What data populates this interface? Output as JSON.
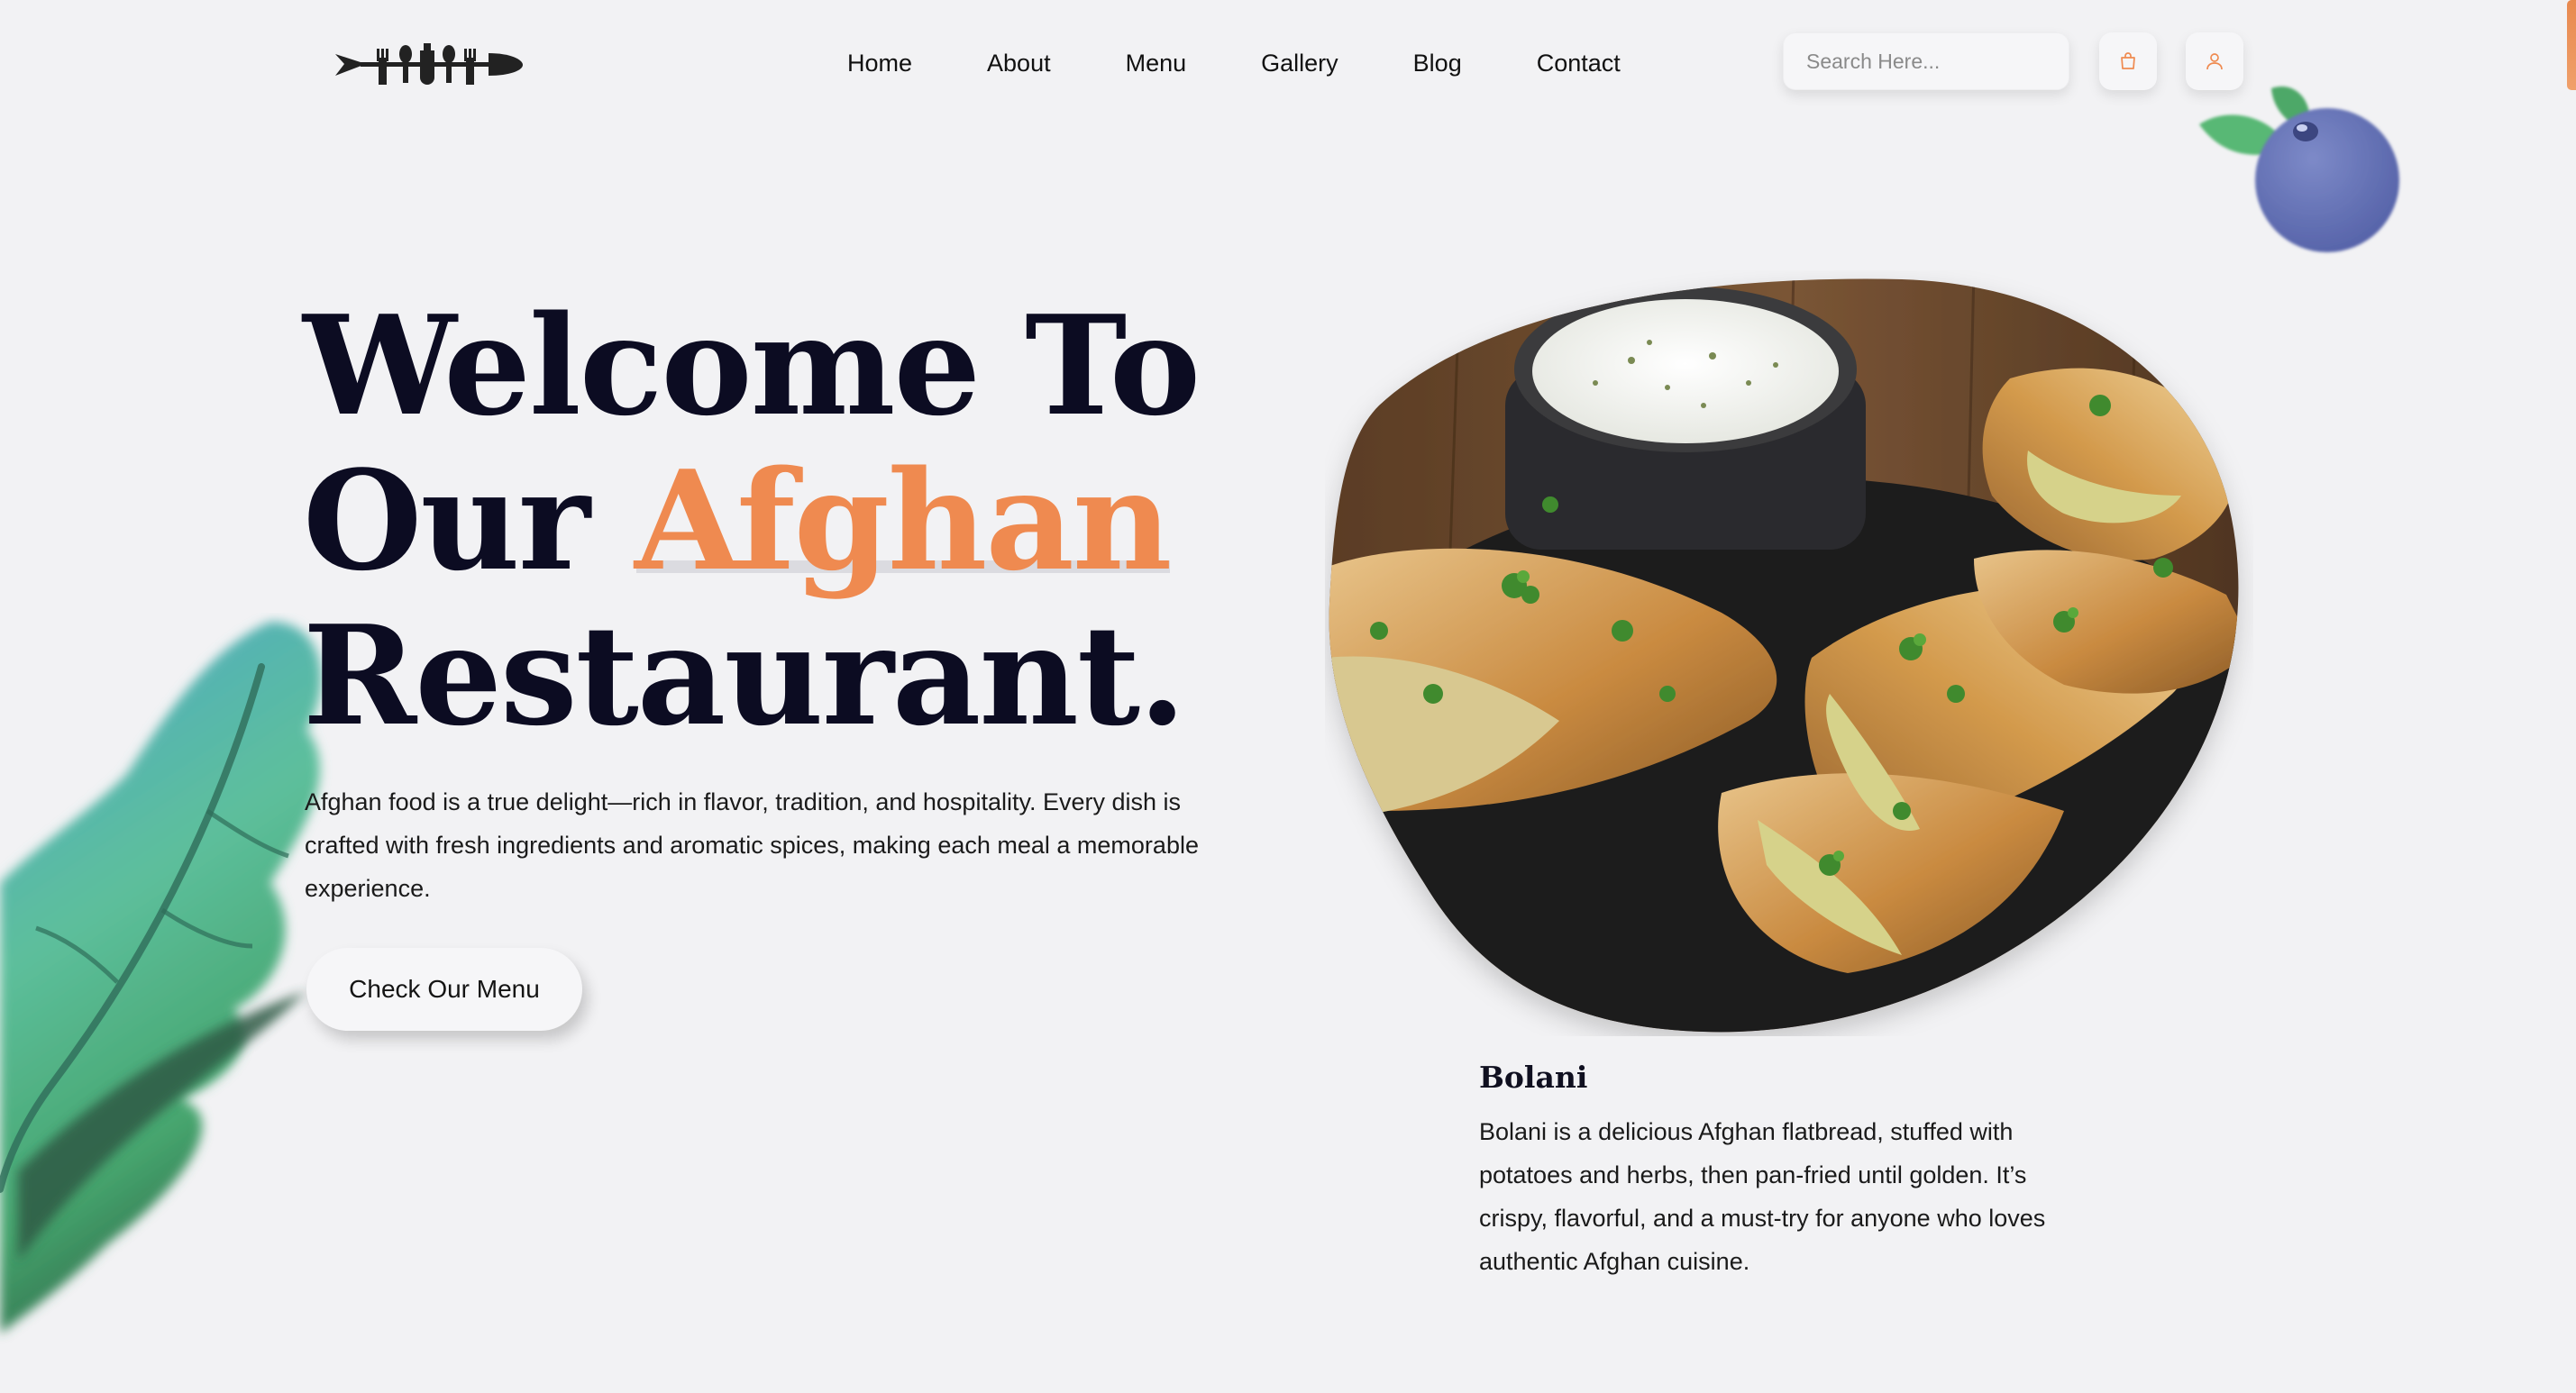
{
  "header": {
    "logo_alt": "Afghan Restaurant",
    "nav": [
      {
        "label": "Home"
      },
      {
        "label": "About"
      },
      {
        "label": "Menu"
      },
      {
        "label": "Gallery"
      },
      {
        "label": "Blog"
      },
      {
        "label": "Contact"
      }
    ],
    "search": {
      "placeholder": "Search Here..."
    },
    "icons": {
      "cart": "shopping-bag-icon",
      "user": "user-icon"
    }
  },
  "hero": {
    "title_line1": "Welcome To",
    "title_line2_prefix": "Our",
    "title_line2_accent": "Afghan",
    "title_line3": "Restaurant.",
    "description": "Afghan food is a true delight—rich in flavor, tradition, and hospitality. Every dish is crafted with fresh ingredients and aromatic spices, making each meal a memorable experience.",
    "cta_label": "Check Our Menu"
  },
  "featured": {
    "image_alt": "Bolani",
    "title": "Bolani",
    "description": "Bolani is a delicious Afghan flatbread, stuffed with potatoes and herbs, then pan-fried until golden. It’s crispy, flavorful, and a must-try for anyone who loves authentic Afghan cuisine."
  },
  "colors": {
    "accent": "#ef8a50",
    "heading": "#0c0c22",
    "background": "#f2f2f4"
  }
}
